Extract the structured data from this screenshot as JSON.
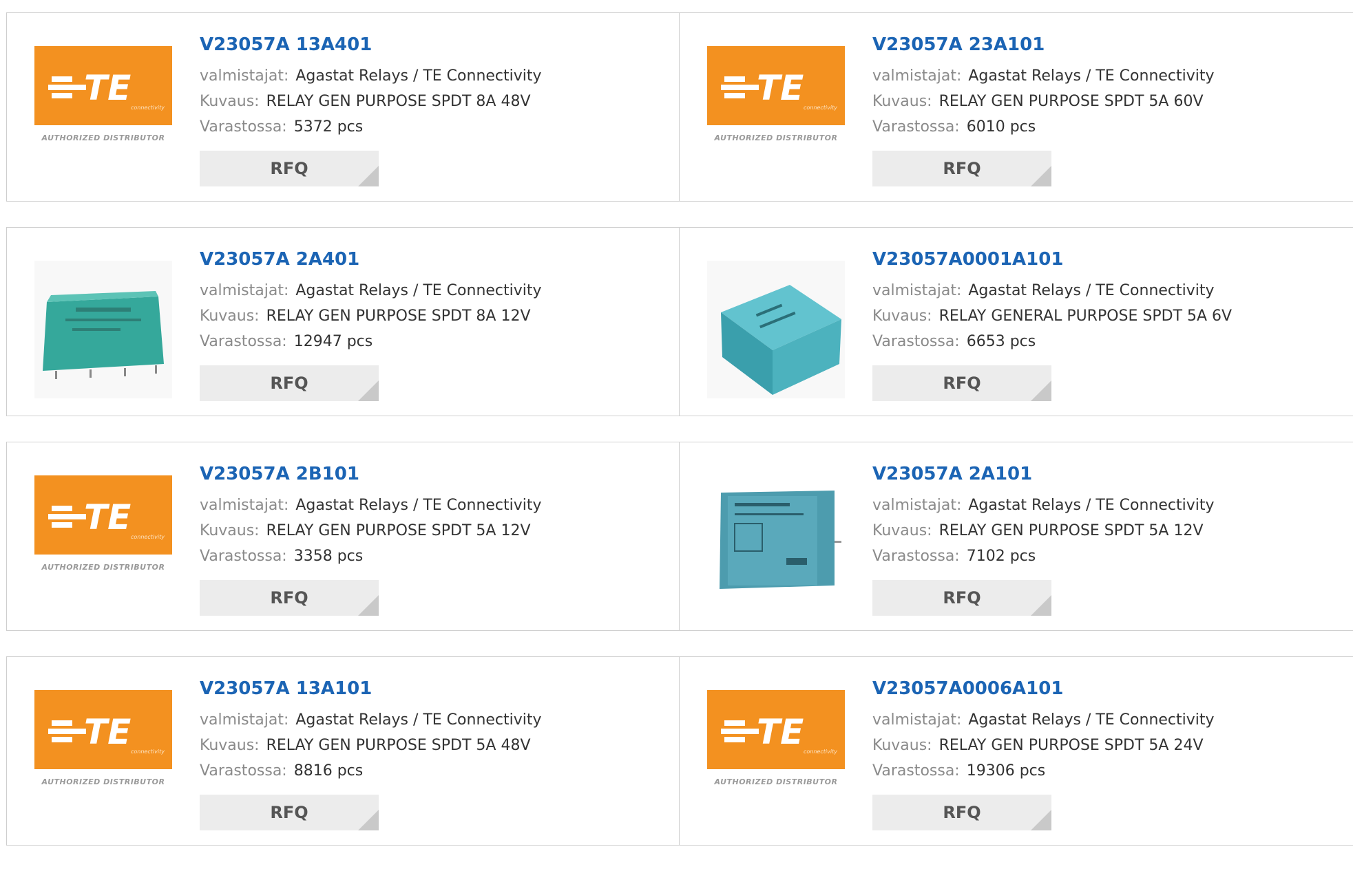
{
  "labels": {
    "manufacturer": "valmistajat:",
    "description": "Kuvaus:",
    "stock": "Varastossa:",
    "rfq": "RFQ"
  },
  "products": [
    {
      "part": "V23057A 13A401",
      "manufacturer": "Agastat Relays / TE Connectivity",
      "description": "RELAY GEN PURPOSE SPDT 8A 48V",
      "stock": "5372 pcs",
      "image": "te-logo"
    },
    {
      "part": "V23057A 23A101",
      "manufacturer": "Agastat Relays / TE Connectivity",
      "description": "RELAY GEN PURPOSE SPDT 5A 60V",
      "stock": "6010 pcs",
      "image": "te-logo"
    },
    {
      "part": "V23057A 2A401",
      "manufacturer": "Agastat Relays / TE Connectivity",
      "description": "RELAY GEN PURPOSE SPDT 8A 12V",
      "stock": "12947 pcs",
      "image": "relay-photo"
    },
    {
      "part": "V23057A0001A101",
      "manufacturer": "Agastat Relays / TE Connectivity",
      "description": "RELAY GENERAL PURPOSE SPDT 5A 6V",
      "stock": "6653 pcs",
      "image": "relay-photo"
    },
    {
      "part": "V23057A 2B101",
      "manufacturer": "Agastat Relays / TE Connectivity",
      "description": "RELAY GEN PURPOSE SPDT 5A 12V",
      "stock": "3358 pcs",
      "image": "te-logo"
    },
    {
      "part": "V23057A 2A101",
      "manufacturer": "Agastat Relays / TE Connectivity",
      "description": "RELAY GEN PURPOSE SPDT 5A 12V",
      "stock": "7102 pcs",
      "image": "relay-photo"
    },
    {
      "part": "V23057A 13A101",
      "manufacturer": "Agastat Relays / TE Connectivity",
      "description": "RELAY GEN PURPOSE SPDT 5A 48V",
      "stock": "8816 pcs",
      "image": "te-logo"
    },
    {
      "part": "V23057A0006A101",
      "manufacturer": "Agastat Relays / TE Connectivity",
      "description": "RELAY GEN PURPOSE SPDT 5A 24V",
      "stock": "19306 pcs",
      "image": "te-logo"
    }
  ],
  "te_logo": {
    "wordmark": "TE",
    "tagline": "connectivity",
    "badge": "AUTHORIZED DISTRIBUTOR"
  },
  "colors": {
    "link": "#1b64b4",
    "te_orange": "#f39120",
    "relay_teal": "#3fa7b0"
  }
}
